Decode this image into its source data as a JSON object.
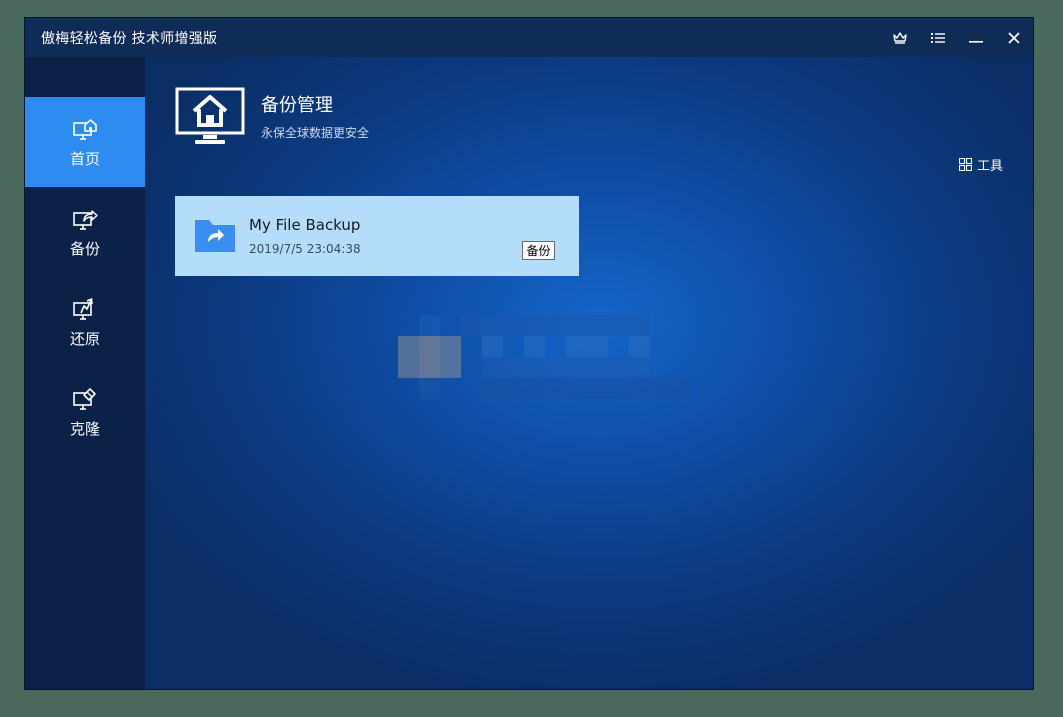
{
  "window": {
    "title": "傲梅轻松备份 技术师增强版"
  },
  "titlebar_controls": [
    {
      "icon": "crown-icon"
    },
    {
      "icon": "menu-icon"
    },
    {
      "icon": "minimize-icon"
    },
    {
      "icon": "close-icon"
    }
  ],
  "sidebar": {
    "items": [
      {
        "label": "首页",
        "icon": "home-monitor-icon",
        "active": true
      },
      {
        "label": "备份",
        "icon": "backup-monitor-icon",
        "active": false
      },
      {
        "label": "还原",
        "icon": "restore-monitor-icon",
        "active": false
      },
      {
        "label": "克隆",
        "icon": "clone-monitor-icon",
        "active": false
      }
    ]
  },
  "header": {
    "title": "备份管理",
    "subtitle": "永保全球数据更安全"
  },
  "tools": {
    "label": "工具",
    "icon": "grid-icon"
  },
  "backup_card": {
    "name": "My File Backup",
    "timestamp": "2019/7/5 23:04:38",
    "action_label": "备份",
    "icon": "folder-share-icon"
  },
  "colors": {
    "accent": "#2e8bf0",
    "card_bg": "#b4ddfb",
    "folder": "#3a8ef0"
  }
}
